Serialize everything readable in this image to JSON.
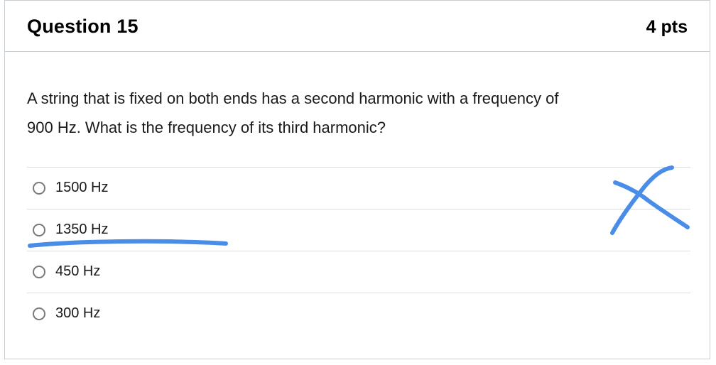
{
  "question": {
    "title": "Question 15",
    "points": "4 pts",
    "text_line1": "A string that is fixed on both ends has a second harmonic with a frequency of",
    "text_line2": "900 Hz. What is the frequency of its third harmonic?"
  },
  "answers": [
    {
      "label": "1500 Hz",
      "selected": false
    },
    {
      "label": "1350 Hz",
      "selected": false
    },
    {
      "label": "450 Hz",
      "selected": false
    },
    {
      "label": "300 Hz",
      "selected": false
    }
  ],
  "annotations": {
    "ink_color": "#4a8de8",
    "marks": [
      "underline-under-1350-hz",
      "cross-mark"
    ]
  }
}
